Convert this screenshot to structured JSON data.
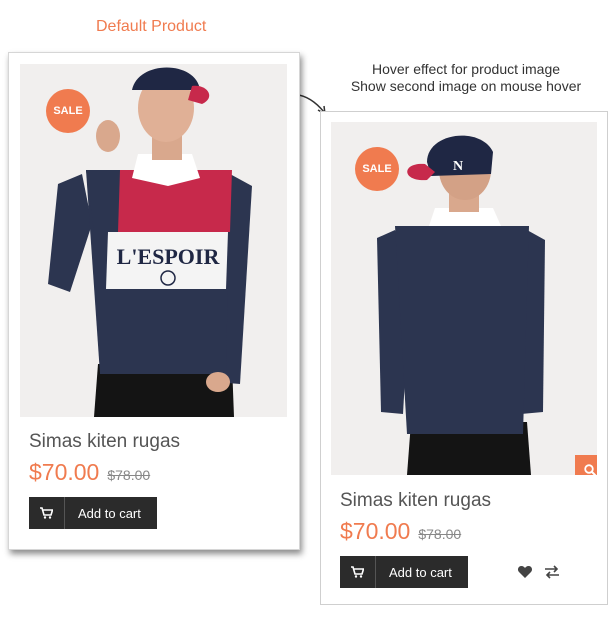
{
  "headings": {
    "default_product": "Default Product",
    "hover_line1": "Hover effect for product image",
    "hover_line2": "Show second image on mouse hover"
  },
  "colors": {
    "accent": "#f07b4f",
    "button_dark": "#2b2b2b",
    "shirt_navy": "#2c3550",
    "shirt_red": "#c7294b"
  },
  "products": [
    {
      "badge": "SALE",
      "title": "Simas kiten rugas",
      "price": "$70.00",
      "old_price": "$78.00",
      "cart_label": "Add to cart",
      "icon": "cart-icon",
      "shirt_print": "L'ESPOIR"
    },
    {
      "badge": "SALE",
      "title": "Simas kiten rugas",
      "price": "$70.00",
      "old_price": "$78.00",
      "cart_label": "Add to cart",
      "icons": [
        "search-icon",
        "cart-icon",
        "heart-icon",
        "compare-icon"
      ]
    }
  ]
}
